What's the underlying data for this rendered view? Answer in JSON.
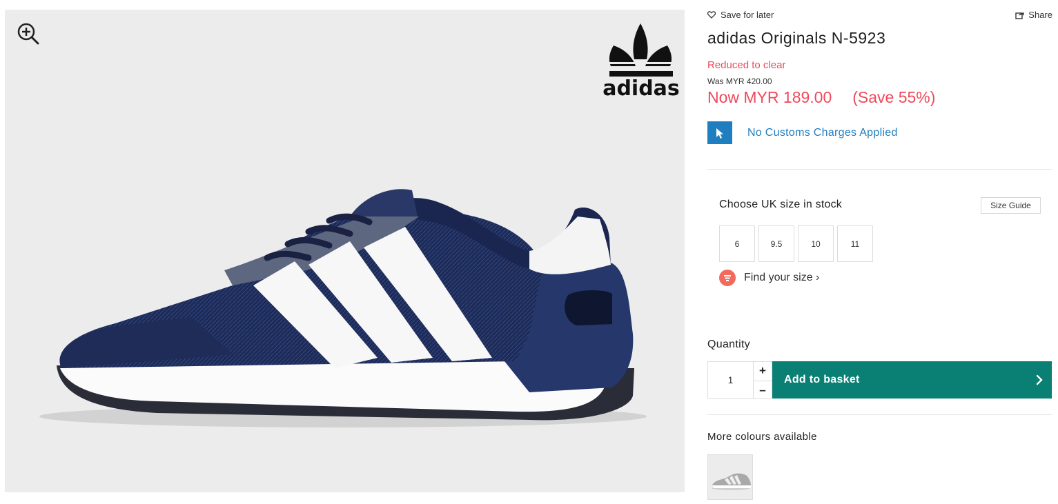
{
  "product": {
    "title": "adidas Originals N-5923",
    "brand_logo_text": "adidas"
  },
  "actions": {
    "save_for_later": "Save for later",
    "share": "Share"
  },
  "pricing": {
    "status": "Reduced to clear",
    "was": "Was MYR 420.00",
    "now": "Now MYR 189.00",
    "save": "(Save 55%)",
    "sale_color": "#f0485a"
  },
  "customs": {
    "text": "No Customs Charges Applied",
    "color": "#1f7ec0"
  },
  "sizing": {
    "title": "Choose UK size in stock",
    "guide_label": "Size Guide",
    "sizes": [
      "6",
      "9.5",
      "10",
      "11"
    ],
    "find_size": "Find your size ›"
  },
  "quantity": {
    "label": "Quantity",
    "value": "1",
    "plus": "+",
    "minus": "–"
  },
  "basket": {
    "label": "Add to basket",
    "color": "#0a7f73"
  },
  "colours": {
    "label": "More colours available"
  },
  "icons": {
    "zoom": "zoom-in-icon",
    "heart": "heart-outline-icon",
    "share": "share-icon",
    "cursor": "cursor-arrow-icon",
    "find_size": "ruler-icon",
    "basket_chevron": "chevron-right-icon"
  }
}
